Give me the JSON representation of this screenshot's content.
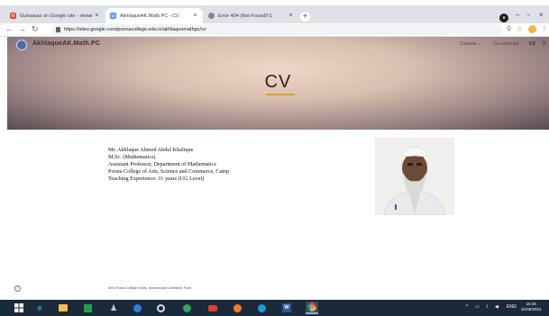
{
  "browser": {
    "tabs": [
      {
        "label": "Gulnawaz on Google site - shown...",
        "icon": "gmail-icon",
        "active": false
      },
      {
        "label": "AkhlaqueAK.Math.PC - CV",
        "icon": "google-sites-icon",
        "active": true
      },
      {
        "label": "Error 404 (Not Found)!!1",
        "icon": "globe-icon",
        "active": false
      }
    ],
    "new_tab": "+",
    "url": "https://sites.google.com/poonacollege.edu.in/akhlaquemathpc/cv"
  },
  "site": {
    "name": "AkhlaqueAK.Math.PC",
    "nav": [
      {
        "label": "Courses ⌄"
      },
      {
        "label": "Co-curricular"
      },
      {
        "label": "CV"
      }
    ],
    "hero_title": "CV"
  },
  "bio": {
    "lines": [
      "Mr. Akhlaque Ahmed Abdul Khalique",
      "M.Sc. (Mathematics)",
      "Assistant Professor, Department of Mathematics",
      "Poona College of Arts, Science and Commerce, Camp",
      "Teaching Experience: 31 years (UG Level)"
    ]
  },
  "footer": {
    "text": "AKI's Poona College of Arts, Science and Commerce, Pune"
  },
  "taskbar": {
    "language": "ENG",
    "time": "15:26",
    "date": "31/08/2021"
  },
  "colors": {
    "accent_line": "#d4a23a",
    "taskbar": "#1b2a3a",
    "tabbar": "#dee1e6"
  }
}
